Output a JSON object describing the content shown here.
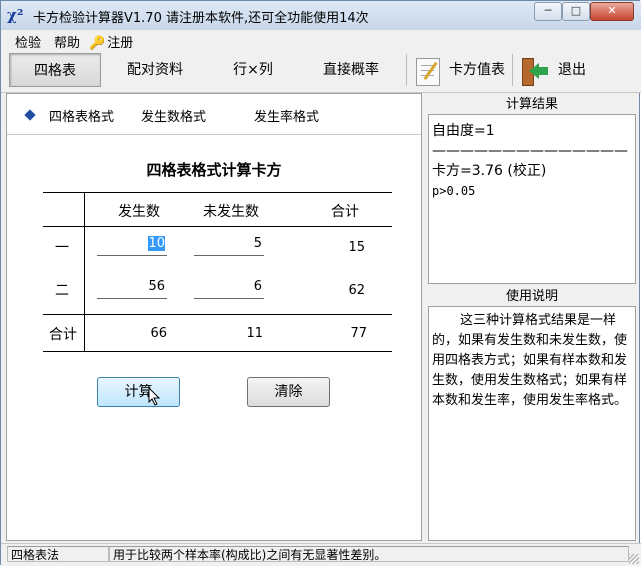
{
  "window": {
    "icon": "χ²",
    "title": "卡方检验计算器V1.70    请注册本软件,还可全功能使用14次",
    "min_label": "─",
    "max_label": "□",
    "close_label": "✕"
  },
  "menu": {
    "items": [
      "检验",
      "帮助",
      "注册"
    ],
    "register_icon": "key-icon"
  },
  "toolbar": {
    "tabs": [
      "四格表",
      "配对资料",
      "行×列",
      "直接概率"
    ],
    "active_tab": "四格表",
    "chi_table_label": "卡方值表",
    "exit_label": "退出"
  },
  "format_bar": {
    "items": [
      "四格表格式",
      "发生数格式",
      "发生率格式"
    ],
    "selected": "四格表格式"
  },
  "table": {
    "title": "四格表格式计算卡方",
    "headers": [
      "发生数",
      "未发生数",
      "合计"
    ],
    "rows": [
      {
        "label": "一",
        "a": "10",
        "b": "5",
        "total": "15"
      },
      {
        "label": "二",
        "a": "56",
        "b": "6",
        "total": "62"
      }
    ],
    "total_row": {
      "label": "合计",
      "a": "66",
      "b": "11",
      "total": "77"
    }
  },
  "buttons": {
    "calc": "计算",
    "clear": "清除"
  },
  "results": {
    "header": "计算结果",
    "line1": "自由度=1",
    "divider": "——————————————",
    "line2": "卡方=3.76 (校正)",
    "line3": "p>0.05"
  },
  "usage": {
    "header": "使用说明",
    "text": "这三种计算格式结果是一样的，如果有发生数和未发生数，使用四格表方式；如果有样本数和发生数，使用发生数格式；如果有样本数和发生率，使用发生率格式。"
  },
  "status": {
    "mode": "四格表法",
    "message": "用于比较两个样本率(构成比)之间有无显著性差别。"
  }
}
